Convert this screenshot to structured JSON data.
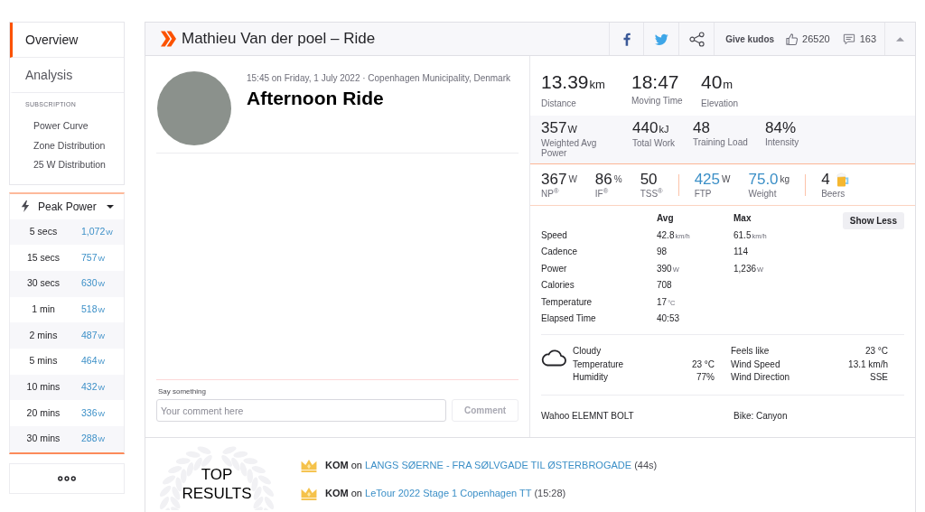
{
  "sidebar": {
    "nav": [
      {
        "label": "Overview",
        "selected": true
      },
      {
        "label": "Analysis",
        "selected": false
      }
    ],
    "subscription_heading": "SUBSCRIPTION",
    "subscription_links": [
      "Power Curve",
      "Zone Distribution",
      "25 W Distribution"
    ]
  },
  "peak_power": {
    "title": "Peak Power",
    "rows": [
      {
        "duration": "5 secs",
        "value": "1,072",
        "unit": "W"
      },
      {
        "duration": "15 secs",
        "value": "757",
        "unit": "W"
      },
      {
        "duration": "30 secs",
        "value": "630",
        "unit": "W"
      },
      {
        "duration": "1 min",
        "value": "518",
        "unit": "W"
      },
      {
        "duration": "2 mins",
        "value": "487",
        "unit": "W"
      },
      {
        "duration": "5 mins",
        "value": "464",
        "unit": "W"
      },
      {
        "duration": "10 mins",
        "value": "432",
        "unit": "W"
      },
      {
        "duration": "20 mins",
        "value": "336",
        "unit": "W"
      },
      {
        "duration": "30 mins",
        "value": "288",
        "unit": "W"
      }
    ]
  },
  "activity": {
    "header": {
      "title": "Mathieu Van der poel – Ride",
      "kudos_button": "Give kudos",
      "kudos_count": "26520",
      "comment_count": "163"
    },
    "when_where": "15:45 on Friday, 1 July 2022 · Copenhagen Municipality, Denmark",
    "name": "Afternoon Ride",
    "comment": {
      "label": "Say something",
      "placeholder": "Your comment here",
      "button": "Comment",
      "button_disabled": true
    }
  },
  "stats": {
    "primary": [
      {
        "value": "13.39",
        "unit": "km",
        "label": "Distance"
      },
      {
        "value": "18:47",
        "label": "Moving Time"
      },
      {
        "value": "40",
        "unit": "m",
        "label": "Elevation"
      }
    ],
    "secondary": [
      {
        "value": "357",
        "unit": "W",
        "label": "Weighted Avg Power"
      },
      {
        "value": "440",
        "unit": "kJ",
        "label": "Total Work"
      },
      {
        "value": "48",
        "label": "Training Load"
      },
      {
        "value": "84%",
        "label": "Intensity"
      }
    ],
    "power_groups": [
      [
        {
          "kind": "metric",
          "value": "367",
          "unit": "W",
          "label": "NP$^{®}$"
        },
        {
          "kind": "metric",
          "value": "86",
          "unit": "%",
          "label": "IF$^{®}$"
        },
        {
          "kind": "metric",
          "value": "50",
          "label": "TSS$^{®}$"
        }
      ],
      [
        {
          "kind": "setting",
          "value": "425",
          "unit": "W",
          "label": "FTP"
        },
        {
          "kind": "setting",
          "value": "75.0",
          "unit": "kg",
          "label": "Weight"
        }
      ],
      [
        {
          "kind": "beers",
          "value": "4",
          "label": "Beers"
        }
      ]
    ]
  },
  "details": {
    "columns": [
      "Avg",
      "Max"
    ],
    "toggle_button": "Show Less",
    "rows": [
      {
        "label": "Speed",
        "avg": {
          "value": "42.8",
          "unit": "km/h"
        },
        "max": {
          "value": "61.5",
          "unit": "km/h"
        }
      },
      {
        "label": "Cadence",
        "avg": {
          "value": "98"
        },
        "max": {
          "value": "114"
        }
      },
      {
        "label": "Power",
        "avg": {
          "value": "390",
          "unit": "W"
        },
        "max": {
          "value": "1,236",
          "unit": "W"
        }
      },
      {
        "label": "Calories",
        "avg": {
          "value": "708"
        }
      },
      {
        "label": "Temperature",
        "avg": {
          "value": "17",
          "unit": "°C"
        }
      },
      {
        "label": "Elapsed Time",
        "avg": {
          "value": "40:53"
        }
      }
    ]
  },
  "weather": {
    "condition": "Cloudy",
    "left": [
      {
        "label": "Temperature",
        "value": "23 °C"
      },
      {
        "label": "Humidity",
        "value": "77%"
      }
    ],
    "right": [
      {
        "label": "Feels like",
        "value": "23 °C"
      },
      {
        "label": "Wind Speed",
        "value": "13.1 km/h"
      },
      {
        "label": "Wind Direction",
        "value": "SSE"
      }
    ]
  },
  "gear": {
    "device": "Wahoo ELEMNT BOLT",
    "bike": "Bike: Canyon"
  },
  "top_results": {
    "title": "TOP RESULTS",
    "results": [
      {
        "achievement": "KOM",
        "connector": "on",
        "segment": "LANGS SØERNE - FRA SØLVGADE TIL ØSTERBROGADE",
        "time": "(44s)"
      },
      {
        "achievement": "KOM",
        "connector": "on",
        "segment": "LeTour 2022 Stage 1 Copenhagen TT",
        "time": "(15:28)"
      }
    ]
  }
}
